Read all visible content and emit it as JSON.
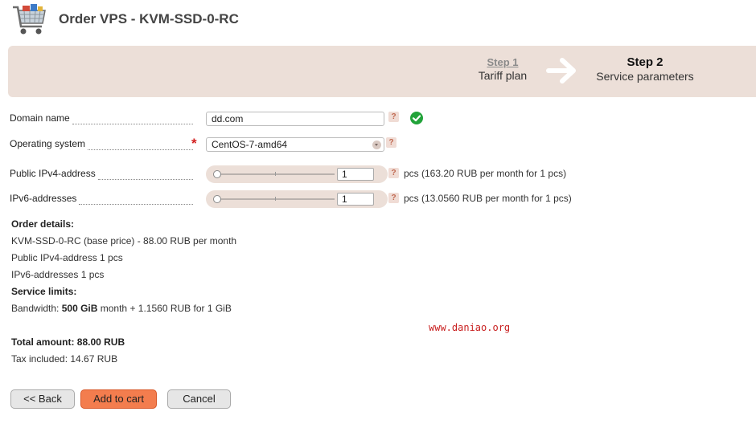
{
  "header": {
    "title": "Order VPS - KVM-SSD-0-RC",
    "icon": "shopping-cart-icon"
  },
  "steps": {
    "step1_title": "Step 1",
    "step1_subtitle": "Tariff plan",
    "arrow": "arrow-right-icon",
    "step2_title": "Step 2",
    "step2_subtitle": "Service parameters"
  },
  "form": {
    "domain": {
      "label": "Domain name",
      "value": "dd.com",
      "help": "?",
      "status_icon": "check-circle-icon"
    },
    "os": {
      "label": "Operating system",
      "required": "*",
      "value": "CentOS-7-amd64",
      "help": "?"
    },
    "ipv4": {
      "label": "Public IPv4-address",
      "value": "1",
      "help": "?",
      "price_text": "pcs (163.20 RUB per month for 1 pcs)",
      "slider_level": 0
    },
    "ipv6": {
      "label": "IPv6-addresses",
      "value": "1",
      "help": "?",
      "price_text": "pcs (13.0560 RUB per month for 1 pcs)",
      "slider_level": 0
    }
  },
  "details": {
    "order_heading": "Order details:",
    "line1": "KVM-SSD-0-RC (base price) - 88.00 RUB per month",
    "line2": "Public IPv4-address 1 pcs",
    "line3": "IPv6-addresses 1 pcs",
    "limits_heading": "Service limits:",
    "bandwidth_prefix": "Bandwidth: ",
    "bandwidth_value": "500 GiB",
    "bandwidth_suffix": " month + 1.1560 RUB for 1 GiB",
    "total": "Total amount: 88.00 RUB",
    "tax": "Tax included: 14.67 RUB"
  },
  "watermark": "www.daniao.org",
  "buttons": {
    "back": "<< Back",
    "add_to_cart": "Add to cart",
    "cancel": "Cancel"
  },
  "colors": {
    "band": "#ecdfd8",
    "accent": "#f37d4e",
    "required": "#d21f1f",
    "success": "#22a33a"
  }
}
